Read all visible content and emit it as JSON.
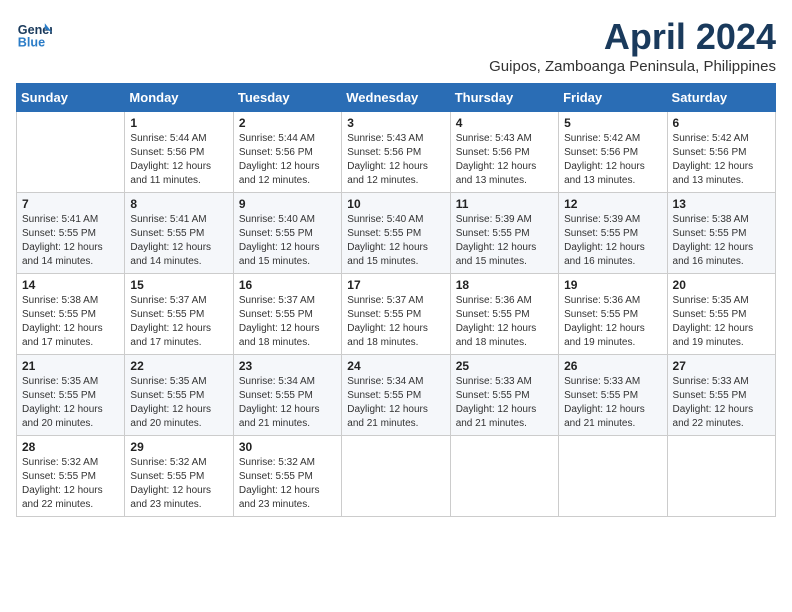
{
  "header": {
    "logo_line1": "General",
    "logo_line2": "Blue",
    "month_title": "April 2024",
    "subtitle": "Guipos, Zamboanga Peninsula, Philippines"
  },
  "calendar": {
    "days_of_week": [
      "Sunday",
      "Monday",
      "Tuesday",
      "Wednesday",
      "Thursday",
      "Friday",
      "Saturday"
    ],
    "weeks": [
      [
        {
          "day": "",
          "info": ""
        },
        {
          "day": "1",
          "info": "Sunrise: 5:44 AM\nSunset: 5:56 PM\nDaylight: 12 hours\nand 11 minutes."
        },
        {
          "day": "2",
          "info": "Sunrise: 5:44 AM\nSunset: 5:56 PM\nDaylight: 12 hours\nand 12 minutes."
        },
        {
          "day": "3",
          "info": "Sunrise: 5:43 AM\nSunset: 5:56 PM\nDaylight: 12 hours\nand 12 minutes."
        },
        {
          "day": "4",
          "info": "Sunrise: 5:43 AM\nSunset: 5:56 PM\nDaylight: 12 hours\nand 13 minutes."
        },
        {
          "day": "5",
          "info": "Sunrise: 5:42 AM\nSunset: 5:56 PM\nDaylight: 12 hours\nand 13 minutes."
        },
        {
          "day": "6",
          "info": "Sunrise: 5:42 AM\nSunset: 5:56 PM\nDaylight: 12 hours\nand 13 minutes."
        }
      ],
      [
        {
          "day": "7",
          "info": "Sunrise: 5:41 AM\nSunset: 5:55 PM\nDaylight: 12 hours\nand 14 minutes."
        },
        {
          "day": "8",
          "info": "Sunrise: 5:41 AM\nSunset: 5:55 PM\nDaylight: 12 hours\nand 14 minutes."
        },
        {
          "day": "9",
          "info": "Sunrise: 5:40 AM\nSunset: 5:55 PM\nDaylight: 12 hours\nand 15 minutes."
        },
        {
          "day": "10",
          "info": "Sunrise: 5:40 AM\nSunset: 5:55 PM\nDaylight: 12 hours\nand 15 minutes."
        },
        {
          "day": "11",
          "info": "Sunrise: 5:39 AM\nSunset: 5:55 PM\nDaylight: 12 hours\nand 15 minutes."
        },
        {
          "day": "12",
          "info": "Sunrise: 5:39 AM\nSunset: 5:55 PM\nDaylight: 12 hours\nand 16 minutes."
        },
        {
          "day": "13",
          "info": "Sunrise: 5:38 AM\nSunset: 5:55 PM\nDaylight: 12 hours\nand 16 minutes."
        }
      ],
      [
        {
          "day": "14",
          "info": "Sunrise: 5:38 AM\nSunset: 5:55 PM\nDaylight: 12 hours\nand 17 minutes."
        },
        {
          "day": "15",
          "info": "Sunrise: 5:37 AM\nSunset: 5:55 PM\nDaylight: 12 hours\nand 17 minutes."
        },
        {
          "day": "16",
          "info": "Sunrise: 5:37 AM\nSunset: 5:55 PM\nDaylight: 12 hours\nand 18 minutes."
        },
        {
          "day": "17",
          "info": "Sunrise: 5:37 AM\nSunset: 5:55 PM\nDaylight: 12 hours\nand 18 minutes."
        },
        {
          "day": "18",
          "info": "Sunrise: 5:36 AM\nSunset: 5:55 PM\nDaylight: 12 hours\nand 18 minutes."
        },
        {
          "day": "19",
          "info": "Sunrise: 5:36 AM\nSunset: 5:55 PM\nDaylight: 12 hours\nand 19 minutes."
        },
        {
          "day": "20",
          "info": "Sunrise: 5:35 AM\nSunset: 5:55 PM\nDaylight: 12 hours\nand 19 minutes."
        }
      ],
      [
        {
          "day": "21",
          "info": "Sunrise: 5:35 AM\nSunset: 5:55 PM\nDaylight: 12 hours\nand 20 minutes."
        },
        {
          "day": "22",
          "info": "Sunrise: 5:35 AM\nSunset: 5:55 PM\nDaylight: 12 hours\nand 20 minutes."
        },
        {
          "day": "23",
          "info": "Sunrise: 5:34 AM\nSunset: 5:55 PM\nDaylight: 12 hours\nand 21 minutes."
        },
        {
          "day": "24",
          "info": "Sunrise: 5:34 AM\nSunset: 5:55 PM\nDaylight: 12 hours\nand 21 minutes."
        },
        {
          "day": "25",
          "info": "Sunrise: 5:33 AM\nSunset: 5:55 PM\nDaylight: 12 hours\nand 21 minutes."
        },
        {
          "day": "26",
          "info": "Sunrise: 5:33 AM\nSunset: 5:55 PM\nDaylight: 12 hours\nand 21 minutes."
        },
        {
          "day": "27",
          "info": "Sunrise: 5:33 AM\nSunset: 5:55 PM\nDaylight: 12 hours\nand 22 minutes."
        }
      ],
      [
        {
          "day": "28",
          "info": "Sunrise: 5:32 AM\nSunset: 5:55 PM\nDaylight: 12 hours\nand 22 minutes."
        },
        {
          "day": "29",
          "info": "Sunrise: 5:32 AM\nSunset: 5:55 PM\nDaylight: 12 hours\nand 23 minutes."
        },
        {
          "day": "30",
          "info": "Sunrise: 5:32 AM\nSunset: 5:55 PM\nDaylight: 12 hours\nand 23 minutes."
        },
        {
          "day": "",
          "info": ""
        },
        {
          "day": "",
          "info": ""
        },
        {
          "day": "",
          "info": ""
        },
        {
          "day": "",
          "info": ""
        }
      ]
    ]
  }
}
